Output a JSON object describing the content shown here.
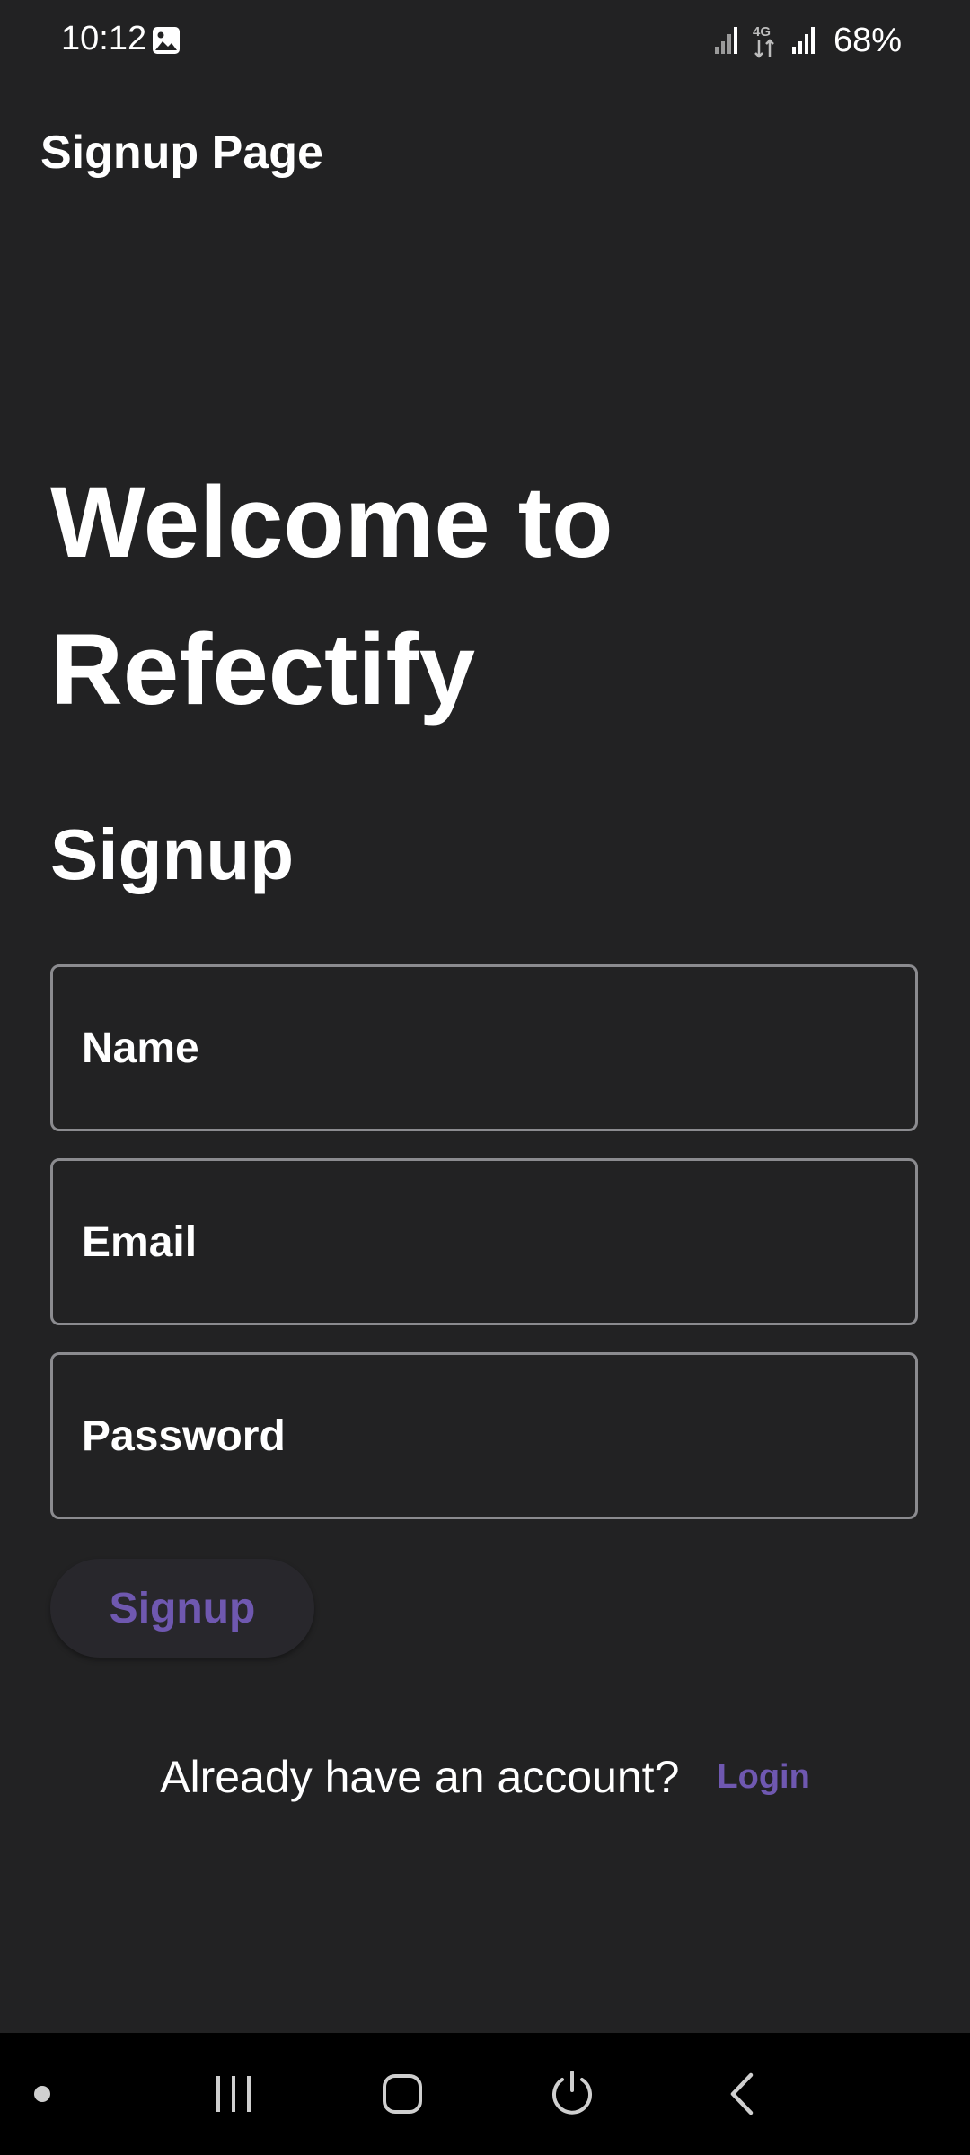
{
  "status_bar": {
    "time": "10:12",
    "network": "4G",
    "battery": "68%",
    "icons": [
      "gallery-icon",
      "signal-icon",
      "network-4g-icon",
      "signal-icon"
    ]
  },
  "app_bar": {
    "title": "Signup Page"
  },
  "main": {
    "welcome_title": "Welcome to Refectify",
    "signup_heading": "Signup",
    "fields": {
      "name": {
        "placeholder": "Name",
        "value": ""
      },
      "email": {
        "placeholder": "Email",
        "value": ""
      },
      "password": {
        "placeholder": "Password",
        "value": ""
      }
    },
    "signup_button_label": "Signup",
    "account_prompt": "Already have an account?",
    "login_link": "Login"
  },
  "nav_bar": {
    "items": [
      "dot-icon",
      "recents-icon",
      "home-icon",
      "power-icon",
      "back-icon"
    ]
  },
  "colors": {
    "background": "#222223",
    "accent": "#6f58b0",
    "field_border": "#8b8b8f",
    "nav_background": "#000000"
  }
}
